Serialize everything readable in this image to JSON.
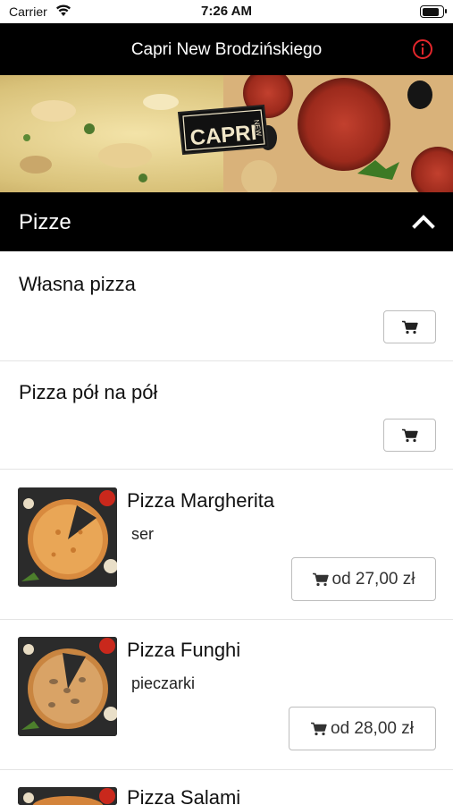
{
  "status_bar": {
    "carrier": "Carrier",
    "time": "7:26 AM",
    "battery_level": 0.9
  },
  "nav": {
    "title": "Capri New Brodzińskiego",
    "info_icon": "info-circle-icon",
    "accent": "#e3262b"
  },
  "hero": {
    "logo_text": "CAPRI",
    "logo_sub": "NEW"
  },
  "category": {
    "title": "Pizze",
    "icon": "chevron-up-icon"
  },
  "products": [
    {
      "name": "Własna pizza",
      "description": "",
      "price": ""
    },
    {
      "name": "Pizza pół na pół",
      "description": "",
      "price": ""
    },
    {
      "name": "Pizza Margherita",
      "description": "ser",
      "price": "od 27,00 zł"
    },
    {
      "name": "Pizza Funghi",
      "description": "pieczarki",
      "price": "od 28,00 zł"
    },
    {
      "name": "Pizza Salami",
      "description": "",
      "price": ""
    }
  ],
  "icons": {
    "cart": "cart-icon"
  }
}
